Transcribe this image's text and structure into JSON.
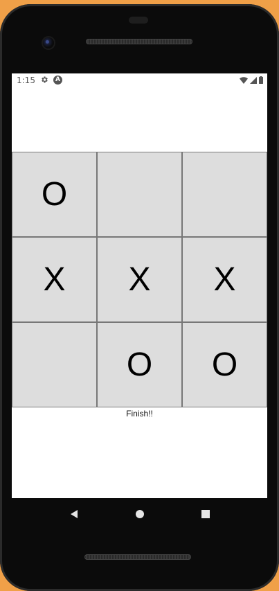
{
  "status_bar": {
    "time": "1:15",
    "icons": [
      "settings-gear-icon",
      "a-circle-icon",
      "wifi-icon",
      "signal-icon",
      "battery-icon"
    ]
  },
  "board": {
    "cells": [
      [
        "O",
        "",
        ""
      ],
      [
        "X",
        "X",
        "X"
      ],
      [
        "",
        "O",
        "O"
      ]
    ]
  },
  "result": {
    "text": "Finish!!"
  },
  "nav": {
    "buttons": [
      "back-icon",
      "home-icon",
      "recents-icon"
    ]
  },
  "colors": {
    "frame_background": "#f0a048",
    "cell_background": "#dddddd",
    "cell_border": "#777777",
    "screen_background": "#ffffff"
  }
}
